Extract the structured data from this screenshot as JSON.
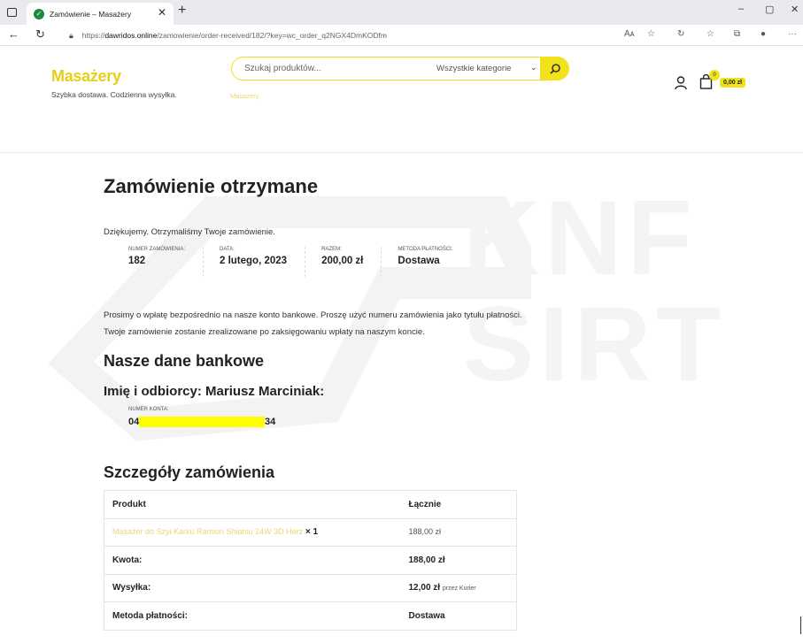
{
  "browser": {
    "tab_title": "Zamówienie – Masażery",
    "url_prefix": "https://",
    "url_host": "dawridos.online",
    "url_path": "/zamowienie/order-received/182/?key=wc_order_q2NGX4DmKODfm",
    "window_minimize": "–",
    "window_maximize": "▢",
    "window_close": "✕"
  },
  "site": {
    "brand": "Masażery",
    "tagline": "Szybka dostawa. Codzienna wysyłka.",
    "search_placeholder": "Szukaj produktów...",
    "search_category": "Wszystkie kategorie",
    "breadcrumb": "Masażery",
    "cart_count": "0",
    "cart_total": "0,00 zł"
  },
  "watermark": [
    "KNF",
    "SIRT"
  ],
  "order": {
    "heading": "Zamówienie otrzymane",
    "thanks": "Dziękujemy. Otrzymaliśmy Twoje zamówienie.",
    "overview": [
      {
        "label": "Numer zamówienia:",
        "value": "182"
      },
      {
        "label": "Data:",
        "value": "2 lutego, 2023"
      },
      {
        "label": "Razem:",
        "value": "200,00 zł"
      },
      {
        "label": "Metoda płatności:",
        "value": "Dostawa"
      }
    ],
    "instructions_line1": "Prosimy o wpłatę bezpośrednio na nasze konto bankowe. Proszę użyć numeru zamówienia jako tytułu płatności.",
    "instructions_line2": "Twoje zamówienie zostanie zrealizowane po zaksięgowaniu wpłaty na naszym koncie."
  },
  "bank": {
    "heading": "Nasze dane bankowe",
    "recipient": "Imię i odbiorcy: Mariusz Marciniak:",
    "account_label": "Numer konta:",
    "account_start": "04",
    "account_end": "34",
    "redaction_color": "#ffff00"
  },
  "details": {
    "heading": "Szczegóły zamówienia",
    "col_product": "Produkt",
    "col_total": "Łącznie",
    "product_name": "Masażer do Szyi Karku Ramion Shiatsu 24W 3D Herz",
    "product_qty": "× 1",
    "product_total": "188,00 zł",
    "subtotal_label": "Kwota:",
    "subtotal_value": "188,00 zł",
    "shipping_label": "Wysyłka:",
    "shipping_value": "12,00 zł",
    "shipping_method": "przez Kurier",
    "payment_label": "Metoda płatności:",
    "payment_value": "Dostawa"
  },
  "colors": {
    "accent": "#f1e21c",
    "brand": "#e6cf1b"
  }
}
